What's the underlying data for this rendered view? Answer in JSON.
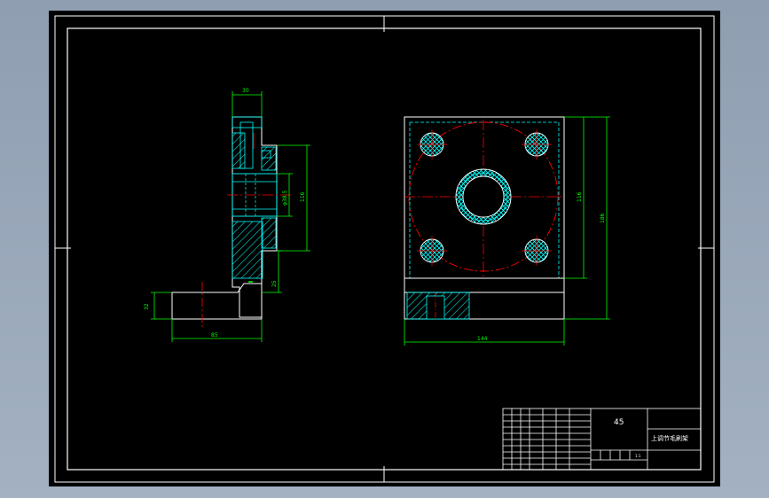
{
  "colors": {
    "background": "#95a4b6",
    "paper": "#000000",
    "frame": "#ffffff",
    "dimension": "#00ff00",
    "centerline": "#ff0000",
    "hidden": "#00ffff",
    "hatch": "#00ffff"
  },
  "title_block": {
    "material": "45",
    "part_name": "上调节毛刷架",
    "scale": "1:1"
  },
  "dimensions": {
    "left_top_width": "30",
    "left_inner_dia": "φ38.5",
    "left_overall_height": "116",
    "left_step": "25",
    "left_bottom_width": "85",
    "left_bottom_height": "32",
    "right_inner_height": "116",
    "right_overall_height": "186",
    "right_width": "144"
  }
}
